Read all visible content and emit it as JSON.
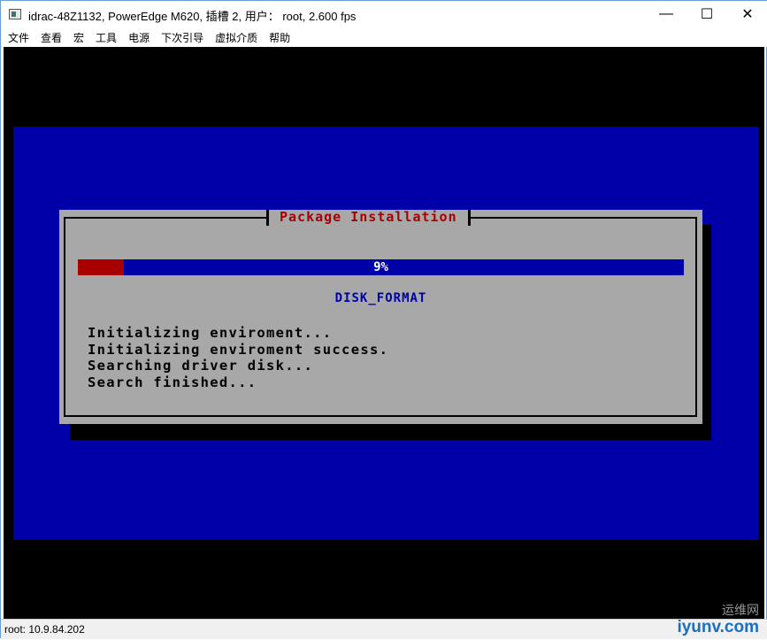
{
  "window": {
    "title": "idrac-48Z1132, PowerEdge M620,  插槽 2, 用户： root, 2.600 fps",
    "minimize": "—",
    "maximize": "☐",
    "close": "✕"
  },
  "menu": [
    "文件",
    "查看",
    "宏",
    "工具",
    "电源",
    "下次引导",
    "虚拟介质",
    "帮助"
  ],
  "dialog": {
    "title": "Package Installation",
    "progress_percent": 9,
    "progress_label": "9%",
    "step": "DISK_FORMAT",
    "log": [
      "Initializing enviroment...",
      "Initializing enviroment success.",
      "Searching driver disk...",
      "Search finished..."
    ]
  },
  "colors": {
    "console_blue": "#0000a8",
    "dialog_gray": "#a8a8a8",
    "progress_red": "#a80000"
  },
  "status": {
    "text": "root: 10.9.84.202"
  },
  "watermark": {
    "cn": "运维网",
    "en": "iyunv.com"
  }
}
